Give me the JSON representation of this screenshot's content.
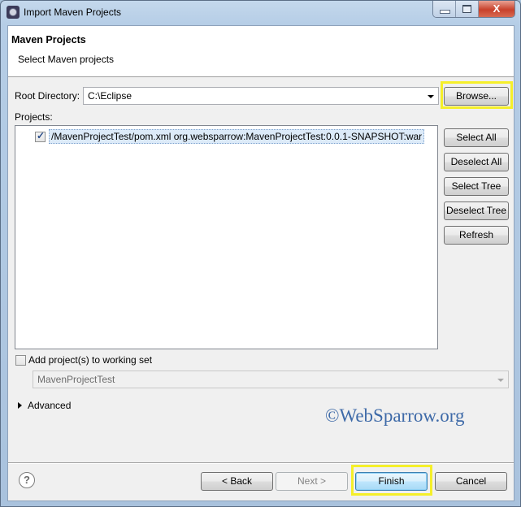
{
  "window": {
    "title": "Import Maven Projects",
    "controls": {
      "minimize": "minimize",
      "maximize": "maximize",
      "close": "X"
    }
  },
  "header": {
    "title": "Maven Projects",
    "subtitle": "Select Maven projects"
  },
  "root_directory": {
    "label": "Root Directory:",
    "value": "C:\\Eclipse",
    "browse_label": "Browse..."
  },
  "projects": {
    "label": "Projects:",
    "items": [
      {
        "checked": true,
        "text": "/MavenProjectTest/pom.xml  org.websparrow:MavenProjectTest:0.0.1-SNAPSHOT:war"
      }
    ],
    "buttons": {
      "select_all": "Select All",
      "deselect_all": "Deselect All",
      "select_tree": "Select Tree",
      "deselect_tree": "Deselect Tree",
      "refresh": "Refresh"
    }
  },
  "working_set": {
    "label": "Add project(s) to working set",
    "checked": false,
    "value": "MavenProjectTest"
  },
  "advanced": {
    "label": "Advanced"
  },
  "watermark": "©WebSparrow.org",
  "footer": {
    "help_glyph": "?",
    "back": "< Back",
    "next": "Next >",
    "finish": "Finish",
    "cancel": "Cancel"
  },
  "highlight_color": "#f5ef2a"
}
